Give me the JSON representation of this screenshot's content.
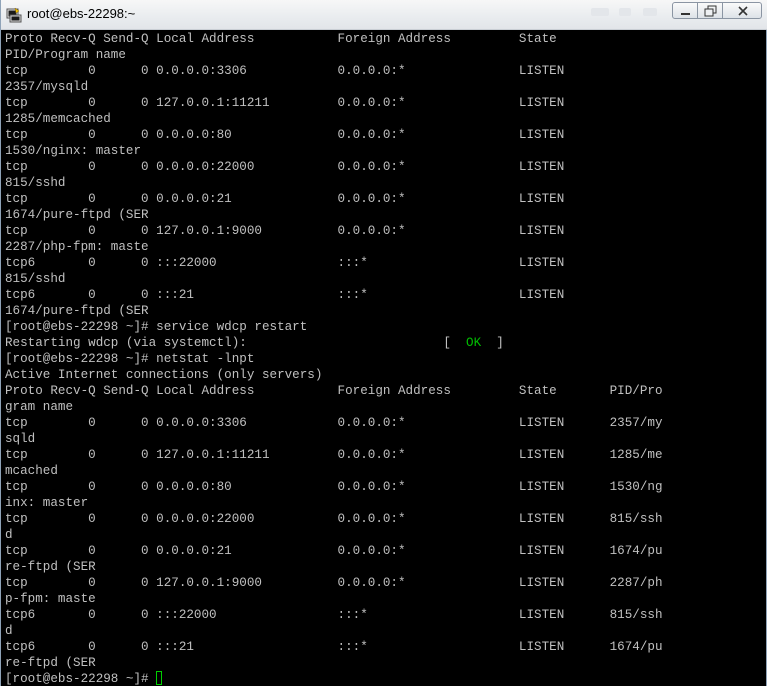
{
  "window": {
    "title": "root@ebs-22298:~",
    "colors": {
      "background": "#000000",
      "text": "#c0c0c0",
      "ok": "#00c000",
      "cursor": "#00d000"
    }
  },
  "terminal": {
    "lines": [
      "Proto Recv-Q Send-Q Local Address           Foreign Address         State",
      "PID/Program name",
      "tcp        0      0 0.0.0.0:3306            0.0.0.0:*               LISTEN",
      "2357/mysqld",
      "tcp        0      0 127.0.0.1:11211         0.0.0.0:*               LISTEN",
      "1285/memcached",
      "tcp        0      0 0.0.0.0:80              0.0.0.0:*               LISTEN",
      "1530/nginx: master",
      "tcp        0      0 0.0.0.0:22000           0.0.0.0:*               LISTEN",
      "815/sshd",
      "tcp        0      0 0.0.0.0:21              0.0.0.0:*               LISTEN",
      "1674/pure-ftpd (SER",
      "tcp        0      0 127.0.0.1:9000          0.0.0.0:*               LISTEN",
      "2287/php-fpm: maste",
      "tcp6       0      0 :::22000                :::*                    LISTEN",
      "815/sshd",
      "tcp6       0      0 :::21                   :::*                    LISTEN",
      "1674/pure-ftpd (SER",
      "[root@ebs-22298 ~]# service wdcp restart",
      "Restarting wdcp (via systemctl):                          [  ",
      "[root@ebs-22298 ~]# netstat -lnpt",
      "Active Internet connections (only servers)",
      "Proto Recv-Q Send-Q Local Address           Foreign Address         State       PID/Pro",
      "gram name",
      "tcp        0      0 0.0.0.0:3306            0.0.0.0:*               LISTEN      2357/my",
      "sqld",
      "tcp        0      0 127.0.0.1:11211         0.0.0.0:*               LISTEN      1285/me",
      "mcached",
      "tcp        0      0 0.0.0.0:80              0.0.0.0:*               LISTEN      1530/ng",
      "inx: master",
      "tcp        0      0 0.0.0.0:22000           0.0.0.0:*               LISTEN      815/ssh",
      "d",
      "tcp        0      0 0.0.0.0:21              0.0.0.0:*               LISTEN      1674/pu",
      "re-ftpd (SER",
      "tcp        0      0 127.0.0.1:9000          0.0.0.0:*               LISTEN      2287/ph",
      "p-fpm: maste",
      "tcp6       0      0 :::22000                :::*                    LISTEN      815/ssh",
      "d",
      "tcp6       0      0 :::21                   :::*                    LISTEN      1674/pu",
      "re-ftpd (SER"
    ],
    "ok_line": {
      "index": 19,
      "ok_text": "OK",
      "suffix": "  ]"
    },
    "prompt": "[root@ebs-22298 ~]# "
  }
}
